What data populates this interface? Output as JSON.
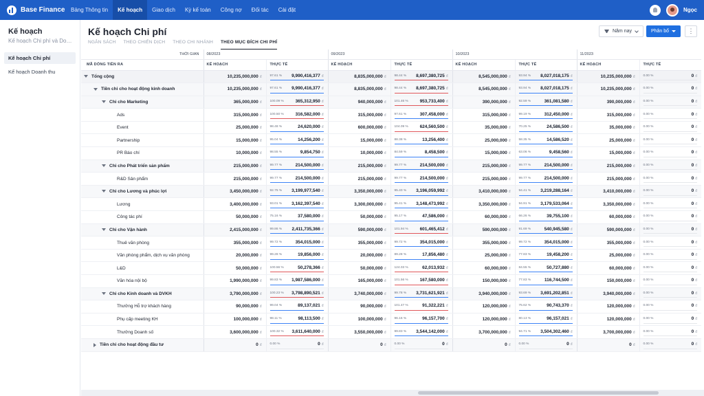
{
  "app": {
    "name": "Base Finance",
    "user": "Ngọc"
  },
  "nav": [
    "Bảng Thông tin",
    "Kế hoạch",
    "Giao dịch",
    "Kỳ kế toán",
    "Công nợ",
    "Đối tác",
    "Cài đặt"
  ],
  "nav_active": 1,
  "sidebar": {
    "title": "Kế hoạch",
    "subtitle": "Kế hoạch Chi phí và Doan...",
    "items": [
      {
        "label": "Kế hoạch Chi phí",
        "active": true
      },
      {
        "label": "Kế hoạch Doanh thu",
        "active": false
      }
    ]
  },
  "page": {
    "title": "Kế hoạch Chi phí",
    "tabs": [
      {
        "label": "NGÂN SÁCH"
      },
      {
        "label": "THEO CHIẾN DỊCH"
      },
      {
        "label": "THEO CHI NHÁNH"
      },
      {
        "label": "THEO MỤC ĐÍCH CHI PHÍ",
        "active": true
      }
    ],
    "filter_label": "Năm nay",
    "primary_label": "Phân bổ",
    "more_label": "⋮"
  },
  "table": {
    "time_label": "THỜI GIAN",
    "code_label": "MÃ DÒNG TIỀN RA",
    "plan_label": "KẾ HOẠCH",
    "actual_label": "THỰC TẾ",
    "currency": "đ",
    "months": [
      "08/2023",
      "09/2023",
      "10/2023",
      "11/2023"
    ],
    "rows": [
      {
        "name": "Tổng cộng",
        "level": 0,
        "tri": "down",
        "cells": [
          [
            "10,235,000,000",
            "97.61 %",
            "9,990,416,377",
            "b"
          ],
          [
            "8,835,000,000",
            "98.44 %",
            "8,697,380,725",
            "r"
          ],
          [
            "8,545,000,000",
            "93.94 %",
            "8,027,018,175",
            "b"
          ],
          [
            "10,235,000,000",
            "0.00 %",
            "0",
            "n"
          ]
        ]
      },
      {
        "name": "Tiền chi cho hoạt động kinh doanh",
        "level": 1,
        "tri": "down",
        "cells": [
          [
            "10,235,000,000",
            "97.61 %",
            "9,990,416,377",
            "b"
          ],
          [
            "8,835,000,000",
            "98.44 %",
            "8,697,380,725",
            "r"
          ],
          [
            "8,545,000,000",
            "93.94 %",
            "8,027,018,175",
            "b"
          ],
          [
            "10,235,000,000",
            "0.00 %",
            "0",
            "n"
          ]
        ]
      },
      {
        "name": "Chi cho Marketing",
        "level": 2,
        "tri": "down",
        "cells": [
          [
            "365,000,000",
            "100.09 %",
            "365,312,950",
            "r"
          ],
          [
            "940,000,000",
            "101.46 %",
            "953,733,400",
            "r"
          ],
          [
            "390,000,000",
            "92.59 %",
            "361,081,580",
            "b"
          ],
          [
            "390,000,000",
            "0.00 %",
            "0",
            "n"
          ]
        ]
      },
      {
        "name": "Ads",
        "level": 3,
        "cells": [
          [
            "315,000,000",
            "100.50 %",
            "316,582,000",
            "r"
          ],
          [
            "315,000,000",
            "97.61 %",
            "307,458,000",
            "b"
          ],
          [
            "315,000,000",
            "99.19 %",
            "312,450,000",
            "b"
          ],
          [
            "315,000,000",
            "0.00 %",
            "0",
            "n"
          ]
        ]
      },
      {
        "name": "Event",
        "level": 3,
        "cells": [
          [
            "25,000,000",
            "98.48 %",
            "24,620,000",
            "b"
          ],
          [
            "600,000,000",
            "104.09 %",
            "624,560,500",
            "r"
          ],
          [
            "35,000,000",
            "70.25 %",
            "24,586,500",
            "b"
          ],
          [
            "35,000,000",
            "0.00 %",
            "0",
            "n"
          ]
        ]
      },
      {
        "name": "Partnership",
        "level": 3,
        "cells": [
          [
            "15,000,000",
            "95.04 %",
            "14,256,200",
            "b"
          ],
          [
            "15,000,000",
            "88.38 %",
            "13,256,400",
            "b"
          ],
          [
            "25,000,000",
            "58.35 %",
            "14,586,520",
            "b"
          ],
          [
            "25,000,000",
            "0.00 %",
            "0",
            "n"
          ]
        ]
      },
      {
        "name": "PR Báo chí",
        "level": 3,
        "cells": [
          [
            "10,000,000",
            "98.55 %",
            "9,854,750",
            "b"
          ],
          [
            "10,000,000",
            "84.59 %",
            "8,458,500",
            "b"
          ],
          [
            "15,000,000",
            "63.06 %",
            "9,458,560",
            "b"
          ],
          [
            "15,000,000",
            "0.00 %",
            "0",
            "n"
          ]
        ]
      },
      {
        "name": "Chi cho Phát triển sản phẩm",
        "level": 2,
        "tri": "down",
        "cells": [
          [
            "215,000,000",
            "99.77 %",
            "214,500,000",
            "b"
          ],
          [
            "215,000,000",
            "99.77 %",
            "214,500,000",
            "b"
          ],
          [
            "215,000,000",
            "99.77 %",
            "214,500,000",
            "b"
          ],
          [
            "215,000,000",
            "0.00 %",
            "0",
            "n"
          ]
        ]
      },
      {
        "name": "R&D Sản phẩm",
        "level": 3,
        "cells": [
          [
            "215,000,000",
            "99.77 %",
            "214,500,000",
            "b"
          ],
          [
            "215,000,000",
            "99.77 %",
            "214,500,000",
            "b"
          ],
          [
            "215,000,000",
            "99.77 %",
            "214,500,000",
            "b"
          ],
          [
            "215,000,000",
            "0.00 %",
            "0",
            "n"
          ]
        ]
      },
      {
        "name": "Chi cho Lương và phúc lợi",
        "level": 2,
        "tri": "down",
        "cells": [
          [
            "3,450,000,000",
            "92.75 %",
            "3,199,977,540",
            "b"
          ],
          [
            "3,350,000,000",
            "95.40 %",
            "3,196,059,992",
            "b"
          ],
          [
            "3,410,000,000",
            "94.41 %",
            "3,219,288,164",
            "b"
          ],
          [
            "3,410,000,000",
            "0.00 %",
            "0",
            "n"
          ]
        ]
      },
      {
        "name": "Lương",
        "level": 3,
        "cells": [
          [
            "3,400,000,000",
            "93.01 %",
            "3,162,397,540",
            "b"
          ],
          [
            "3,300,000,000",
            "95.41 %",
            "3,148,473,992",
            "b"
          ],
          [
            "3,350,000,000",
            "94.91 %",
            "3,179,533,064",
            "b"
          ],
          [
            "3,350,000,000",
            "0.00 %",
            "0",
            "n"
          ]
        ]
      },
      {
        "name": "Công tác phí",
        "level": 3,
        "cells": [
          [
            "50,000,000",
            "75.16 %",
            "37,580,000",
            "b"
          ],
          [
            "50,000,000",
            "95.17 %",
            "47,586,000",
            "b"
          ],
          [
            "60,000,000",
            "66.26 %",
            "39,755,100",
            "b"
          ],
          [
            "60,000,000",
            "0.00 %",
            "0",
            "n"
          ]
        ]
      },
      {
        "name": "Chi cho Vận hành",
        "level": 2,
        "tri": "down",
        "cells": [
          [
            "2,415,000,000",
            "99.86 %",
            "2,411,735,366",
            "b"
          ],
          [
            "590,000,000",
            "101.94 %",
            "601,465,412",
            "r"
          ],
          [
            "590,000,000",
            "91.69 %",
            "540,945,580",
            "b"
          ],
          [
            "590,000,000",
            "0.00 %",
            "0",
            "n"
          ]
        ]
      },
      {
        "name": "Thuê văn phòng",
        "level": 3,
        "cells": [
          [
            "355,000,000",
            "99.72 %",
            "354,015,000",
            "b"
          ],
          [
            "355,000,000",
            "99.72 %",
            "354,015,000",
            "b"
          ],
          [
            "355,000,000",
            "99.72 %",
            "354,015,000",
            "b"
          ],
          [
            "355,000,000",
            "0.00 %",
            "0",
            "n"
          ]
        ]
      },
      {
        "name": "Văn phòng phẩm, dịch vụ văn phòng",
        "level": 3,
        "cells": [
          [
            "20,000,000",
            "99.28 %",
            "19,856,000",
            "b"
          ],
          [
            "20,000,000",
            "89.28 %",
            "17,856,480",
            "b"
          ],
          [
            "25,000,000",
            "77.83 %",
            "19,458,200",
            "b"
          ],
          [
            "25,000,000",
            "0.00 %",
            "0",
            "n"
          ]
        ]
      },
      {
        "name": "L&D",
        "level": 3,
        "cells": [
          [
            "50,000,000",
            "100.56 %",
            "50,278,366",
            "r"
          ],
          [
            "50,000,000",
            "124.03 %",
            "62,013,932",
            "r"
          ],
          [
            "60,000,000",
            "84.55 %",
            "50,727,880",
            "b"
          ],
          [
            "60,000,000",
            "0.00 %",
            "0",
            "n"
          ]
        ]
      },
      {
        "name": "Văn hóa nội bộ",
        "level": 3,
        "cells": [
          [
            "1,990,000,000",
            "99.83 %",
            "1,987,586,000",
            "b"
          ],
          [
            "165,000,000",
            "101.56 %",
            "167,580,000",
            "r"
          ],
          [
            "150,000,000",
            "77.83 %",
            "116,744,500",
            "b"
          ],
          [
            "150,000,000",
            "0.00 %",
            "0",
            "n"
          ]
        ]
      },
      {
        "name": "Chi cho Kinh doanh và DVKH",
        "level": 2,
        "tri": "down",
        "cells": [
          [
            "3,790,000,000",
            "100.23 %",
            "3,798,890,521",
            "r"
          ],
          [
            "3,740,000,000",
            "99.78 %",
            "3,731,621,921",
            "b"
          ],
          [
            "3,940,000,000",
            "93.69 %",
            "3,691,202,851",
            "b"
          ],
          [
            "3,940,000,000",
            "0.00 %",
            "0",
            "n"
          ]
        ]
      },
      {
        "name": "Thưởng Hỗ trợ khách hàng",
        "level": 3,
        "cells": [
          [
            "90,000,000",
            "99.04 %",
            "89,137,021",
            "b"
          ],
          [
            "90,000,000",
            "101.47 %",
            "91,322,221",
            "r"
          ],
          [
            "120,000,000",
            "75.62 %",
            "90,743,370",
            "b"
          ],
          [
            "120,000,000",
            "0.00 %",
            "0",
            "n"
          ]
        ]
      },
      {
        "name": "Phụ cấp meeting KH",
        "level": 3,
        "cells": [
          [
            "100,000,000",
            "98.11 %",
            "98,113,500",
            "b"
          ],
          [
            "100,000,000",
            "96.16 %",
            "96,157,700",
            "b"
          ],
          [
            "120,000,000",
            "80.13 %",
            "96,157,021",
            "b"
          ],
          [
            "120,000,000",
            "0.00 %",
            "0",
            "n"
          ]
        ]
      },
      {
        "name": "Thưởng Doanh số",
        "level": 3,
        "cells": [
          [
            "3,600,000,000",
            "100.32 %",
            "3,611,640,000",
            "r"
          ],
          [
            "3,550,000,000",
            "99.83 %",
            "3,544,142,000",
            "b"
          ],
          [
            "3,700,000,000",
            "94.71 %",
            "3,504,302,460",
            "b"
          ],
          [
            "3,700,000,000",
            "0.00 %",
            "0",
            "n"
          ]
        ]
      },
      {
        "name": "Tiền chi cho hoạt động đầu tư",
        "level": 1,
        "tri": "right",
        "cells": [
          [
            "0",
            "0.00 %",
            "0",
            "n"
          ],
          [
            "0",
            "0.00 %",
            "0",
            "n"
          ],
          [
            "0",
            "0.00 %",
            "0",
            "n"
          ],
          [
            "0",
            "0.00 %",
            "0",
            "n"
          ]
        ]
      }
    ]
  }
}
